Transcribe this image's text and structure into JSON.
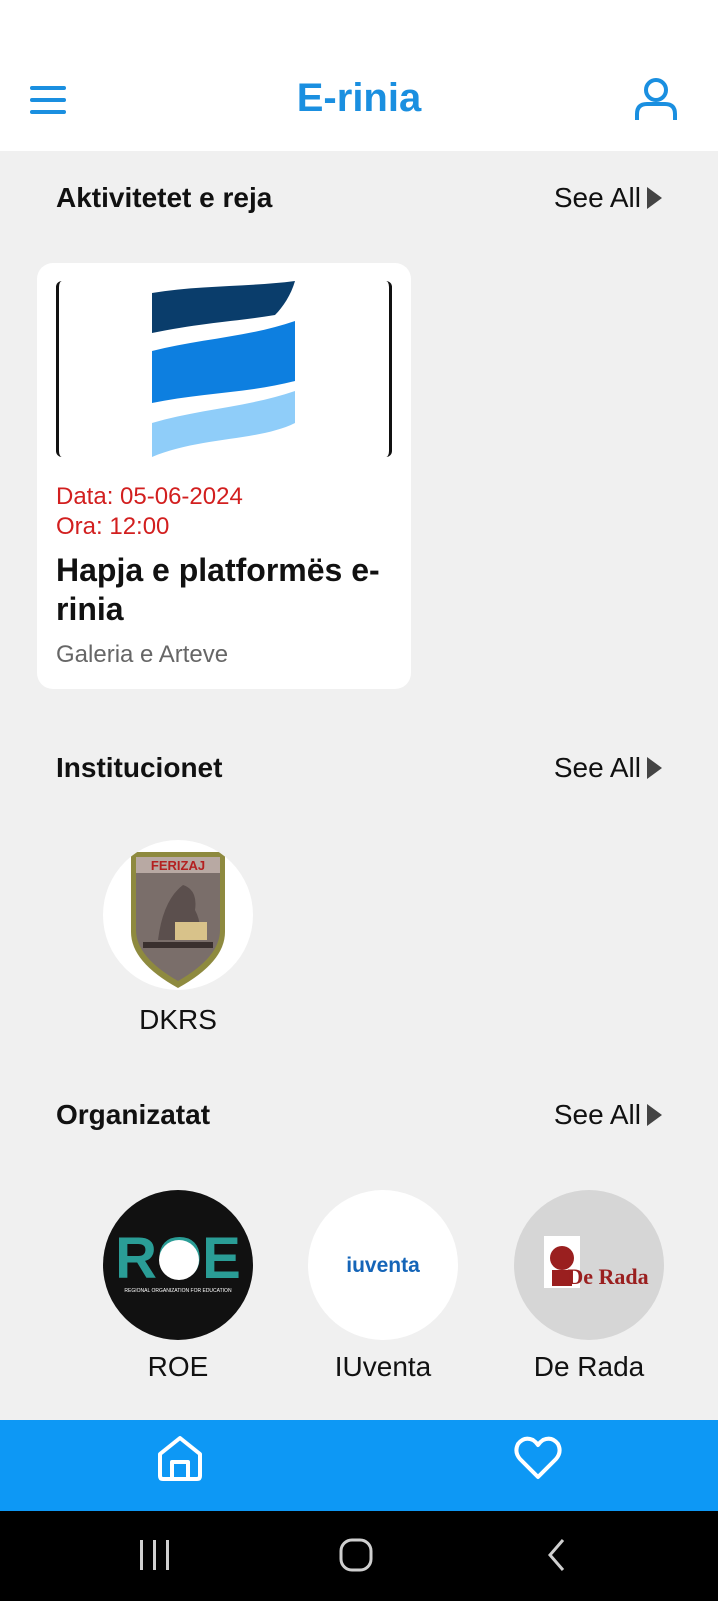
{
  "app": {
    "title": "E-rinia"
  },
  "sections": {
    "activities": {
      "title": "Aktivitetet e reja",
      "see_all": "See All"
    },
    "institutions": {
      "title": "Institucionet",
      "see_all": "See All"
    },
    "organizations": {
      "title": "Organizatat",
      "see_all": "See All"
    }
  },
  "event": {
    "date": "Data: 05-06-2024",
    "time": "Ora: 12:00",
    "title": "Hapja e platformës e-rinia",
    "place": "Galeria e Arteve"
  },
  "institutions": [
    {
      "label": "DKRS",
      "logo_text": "FERIZAJ"
    }
  ],
  "organizations": [
    {
      "label": "ROE",
      "logo_text": "ROE",
      "logo_subtext": "REGIONAL ORGANIZATION FOR EDUCATION"
    },
    {
      "label": "IUventa",
      "logo_text": "iuventa"
    },
    {
      "label": "De Rada",
      "logo_text": "De Rada"
    }
  ],
  "icons": {
    "menu": "menu-icon",
    "user": "user-icon",
    "home": "home-icon",
    "favorites": "heart-icon"
  },
  "colors": {
    "accent": "#1a8fe0",
    "nav_bar": "#0d98f5",
    "date_text": "#d21f1f",
    "background": "#f0f0f0"
  }
}
